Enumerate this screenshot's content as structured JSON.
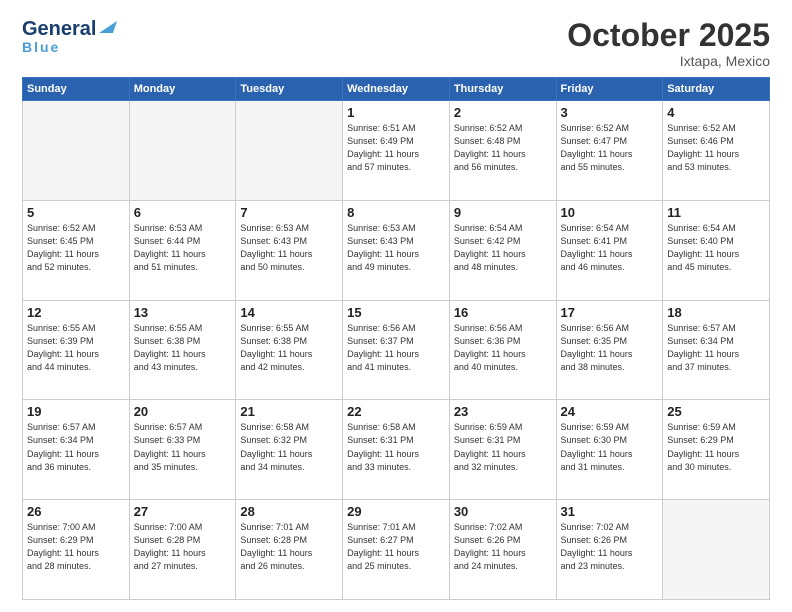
{
  "header": {
    "logo_line1": "General",
    "logo_line2": "Blue",
    "month": "October 2025",
    "location": "Ixtapa, Mexico"
  },
  "weekdays": [
    "Sunday",
    "Monday",
    "Tuesday",
    "Wednesday",
    "Thursday",
    "Friday",
    "Saturday"
  ],
  "weeks": [
    [
      {
        "day": "",
        "info": ""
      },
      {
        "day": "",
        "info": ""
      },
      {
        "day": "",
        "info": ""
      },
      {
        "day": "1",
        "info": "Sunrise: 6:51 AM\nSunset: 6:49 PM\nDaylight: 11 hours\nand 57 minutes."
      },
      {
        "day": "2",
        "info": "Sunrise: 6:52 AM\nSunset: 6:48 PM\nDaylight: 11 hours\nand 56 minutes."
      },
      {
        "day": "3",
        "info": "Sunrise: 6:52 AM\nSunset: 6:47 PM\nDaylight: 11 hours\nand 55 minutes."
      },
      {
        "day": "4",
        "info": "Sunrise: 6:52 AM\nSunset: 6:46 PM\nDaylight: 11 hours\nand 53 minutes."
      }
    ],
    [
      {
        "day": "5",
        "info": "Sunrise: 6:52 AM\nSunset: 6:45 PM\nDaylight: 11 hours\nand 52 minutes."
      },
      {
        "day": "6",
        "info": "Sunrise: 6:53 AM\nSunset: 6:44 PM\nDaylight: 11 hours\nand 51 minutes."
      },
      {
        "day": "7",
        "info": "Sunrise: 6:53 AM\nSunset: 6:43 PM\nDaylight: 11 hours\nand 50 minutes."
      },
      {
        "day": "8",
        "info": "Sunrise: 6:53 AM\nSunset: 6:43 PM\nDaylight: 11 hours\nand 49 minutes."
      },
      {
        "day": "9",
        "info": "Sunrise: 6:54 AM\nSunset: 6:42 PM\nDaylight: 11 hours\nand 48 minutes."
      },
      {
        "day": "10",
        "info": "Sunrise: 6:54 AM\nSunset: 6:41 PM\nDaylight: 11 hours\nand 46 minutes."
      },
      {
        "day": "11",
        "info": "Sunrise: 6:54 AM\nSunset: 6:40 PM\nDaylight: 11 hours\nand 45 minutes."
      }
    ],
    [
      {
        "day": "12",
        "info": "Sunrise: 6:55 AM\nSunset: 6:39 PM\nDaylight: 11 hours\nand 44 minutes."
      },
      {
        "day": "13",
        "info": "Sunrise: 6:55 AM\nSunset: 6:38 PM\nDaylight: 11 hours\nand 43 minutes."
      },
      {
        "day": "14",
        "info": "Sunrise: 6:55 AM\nSunset: 6:38 PM\nDaylight: 11 hours\nand 42 minutes."
      },
      {
        "day": "15",
        "info": "Sunrise: 6:56 AM\nSunset: 6:37 PM\nDaylight: 11 hours\nand 41 minutes."
      },
      {
        "day": "16",
        "info": "Sunrise: 6:56 AM\nSunset: 6:36 PM\nDaylight: 11 hours\nand 40 minutes."
      },
      {
        "day": "17",
        "info": "Sunrise: 6:56 AM\nSunset: 6:35 PM\nDaylight: 11 hours\nand 38 minutes."
      },
      {
        "day": "18",
        "info": "Sunrise: 6:57 AM\nSunset: 6:34 PM\nDaylight: 11 hours\nand 37 minutes."
      }
    ],
    [
      {
        "day": "19",
        "info": "Sunrise: 6:57 AM\nSunset: 6:34 PM\nDaylight: 11 hours\nand 36 minutes."
      },
      {
        "day": "20",
        "info": "Sunrise: 6:57 AM\nSunset: 6:33 PM\nDaylight: 11 hours\nand 35 minutes."
      },
      {
        "day": "21",
        "info": "Sunrise: 6:58 AM\nSunset: 6:32 PM\nDaylight: 11 hours\nand 34 minutes."
      },
      {
        "day": "22",
        "info": "Sunrise: 6:58 AM\nSunset: 6:31 PM\nDaylight: 11 hours\nand 33 minutes."
      },
      {
        "day": "23",
        "info": "Sunrise: 6:59 AM\nSunset: 6:31 PM\nDaylight: 11 hours\nand 32 minutes."
      },
      {
        "day": "24",
        "info": "Sunrise: 6:59 AM\nSunset: 6:30 PM\nDaylight: 11 hours\nand 31 minutes."
      },
      {
        "day": "25",
        "info": "Sunrise: 6:59 AM\nSunset: 6:29 PM\nDaylight: 11 hours\nand 30 minutes."
      }
    ],
    [
      {
        "day": "26",
        "info": "Sunrise: 7:00 AM\nSunset: 6:29 PM\nDaylight: 11 hours\nand 28 minutes."
      },
      {
        "day": "27",
        "info": "Sunrise: 7:00 AM\nSunset: 6:28 PM\nDaylight: 11 hours\nand 27 minutes."
      },
      {
        "day": "28",
        "info": "Sunrise: 7:01 AM\nSunset: 6:28 PM\nDaylight: 11 hours\nand 26 minutes."
      },
      {
        "day": "29",
        "info": "Sunrise: 7:01 AM\nSunset: 6:27 PM\nDaylight: 11 hours\nand 25 minutes."
      },
      {
        "day": "30",
        "info": "Sunrise: 7:02 AM\nSunset: 6:26 PM\nDaylight: 11 hours\nand 24 minutes."
      },
      {
        "day": "31",
        "info": "Sunrise: 7:02 AM\nSunset: 6:26 PM\nDaylight: 11 hours\nand 23 minutes."
      },
      {
        "day": "",
        "info": ""
      }
    ]
  ]
}
